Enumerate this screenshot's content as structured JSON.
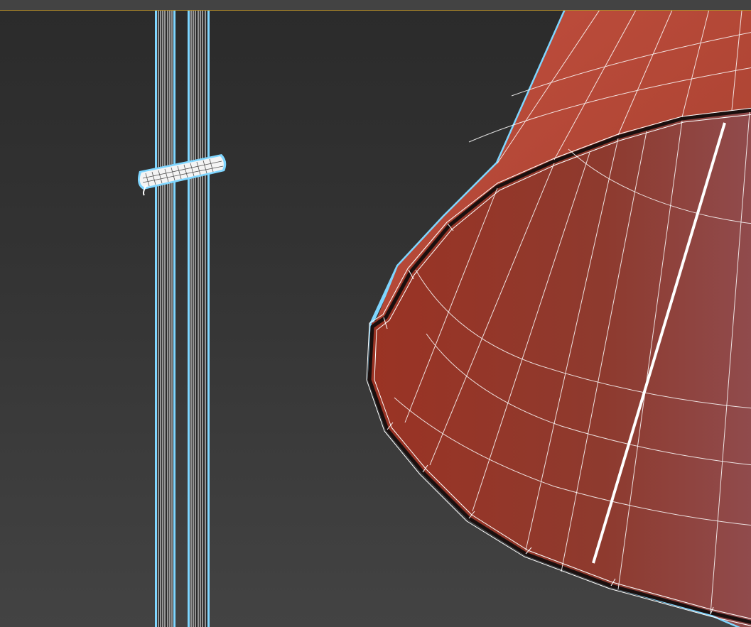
{
  "app": {
    "colors": {
      "viewport_top": "#2b2b2b",
      "viewport_bottom": "#434343",
      "topbar_accent": "#b08a2a",
      "selection_outline": "#7fd6ff",
      "wire": "#ffffff",
      "shade_outer": "#b0493a",
      "shade_inner": "#963828",
      "shade_inner_right": "#8f4a4a"
    },
    "scene": {
      "objects": [
        {
          "name": "pole-left",
          "kind": "cylinder",
          "selected": true
        },
        {
          "name": "pole-right",
          "kind": "cylinder",
          "selected": true
        },
        {
          "name": "pole-clamp",
          "kind": "cylinder",
          "selected": true
        },
        {
          "name": "lamp-shade",
          "kind": "cone",
          "selected": true
        }
      ]
    }
  }
}
